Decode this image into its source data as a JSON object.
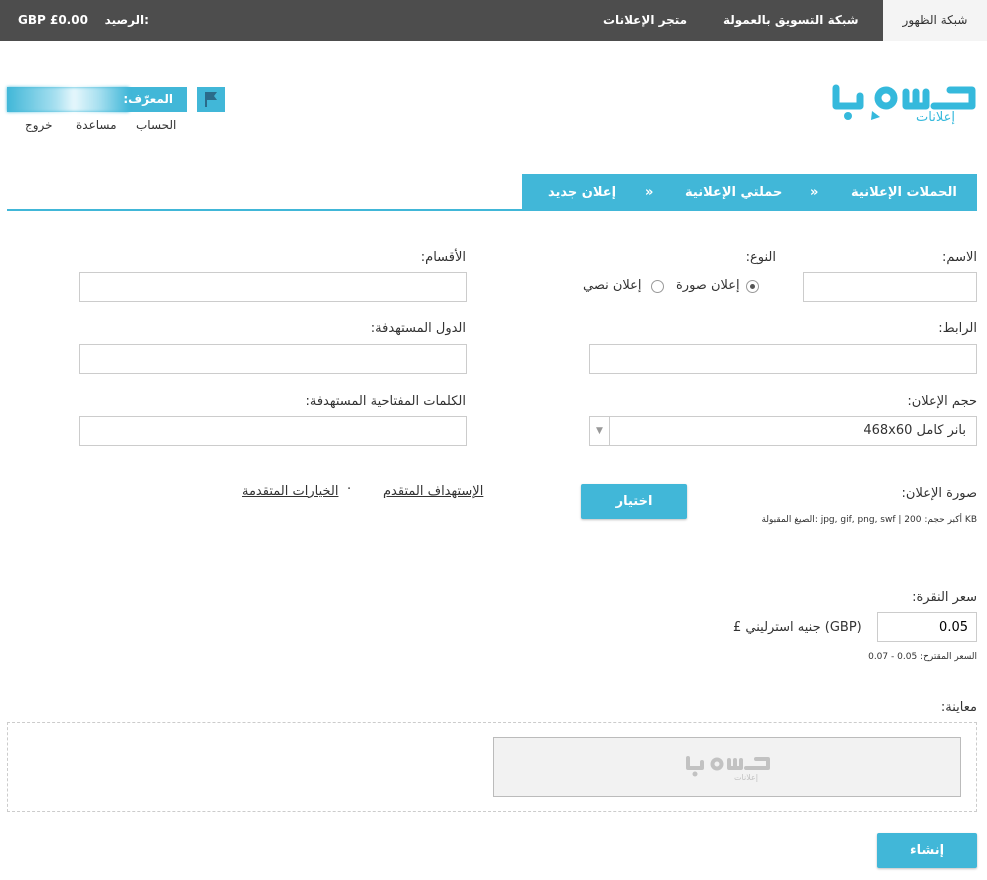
{
  "topbar": {
    "tabs": [
      "شبكة الظهور",
      "شبكة التسويق بالعمولة",
      "متجر الإعلانات"
    ],
    "balance_label": "الرصيد:",
    "balance_value": "GBP £0.00"
  },
  "logo": {
    "text": "حسوب",
    "subtext": "إعلانات"
  },
  "user": {
    "id_label": "المعرّف:",
    "links": [
      "الحساب",
      "مساعدة",
      "خروج"
    ]
  },
  "breadcrumb": {
    "items": [
      "الحملات الإعلانية",
      "حملتي الإعلانية",
      "إعلان جديد"
    ],
    "separator": "»"
  },
  "form": {
    "name_label": "الاسم:",
    "name_value": "",
    "type_label": "النوع:",
    "type_options": [
      "إعلان صورة",
      "إعلان نصي"
    ],
    "type_selected": "إعلان صورة",
    "categories_label": "الأقسام:",
    "categories_value": "",
    "url_label": "الرابط:",
    "url_value": "",
    "countries_label": "الدول المستهدفة:",
    "countries_value": "",
    "size_label": "حجم الإعلان:",
    "size_value": "468x60 بانر كامل",
    "keywords_label": "الكلمات المفتاحية المستهدفة:",
    "keywords_value": "",
    "image_label": "صورة الإعلان:",
    "choose_button": "اختيار",
    "formats_note": "الصيغ المقبولة: jpg, gif, png, swf | أكبر حجم: 200 KB",
    "advanced_targeting_link": "الإستهداف المتقدم",
    "advanced_options_link": "الخيارات المتقدمة",
    "link_separator": "·",
    "cpc_label": "سعر النقرة:",
    "cpc_value": "0.05",
    "currency_label": "£ جنيه استرليني (GBP)",
    "suggested_price": "السعر المقترح: 0.05 - 0.07",
    "preview_label": "معاينة:",
    "create_button": "إنشاء"
  },
  "colors": {
    "accent": "#41b7d8",
    "topbar": "#4d4d4d"
  }
}
